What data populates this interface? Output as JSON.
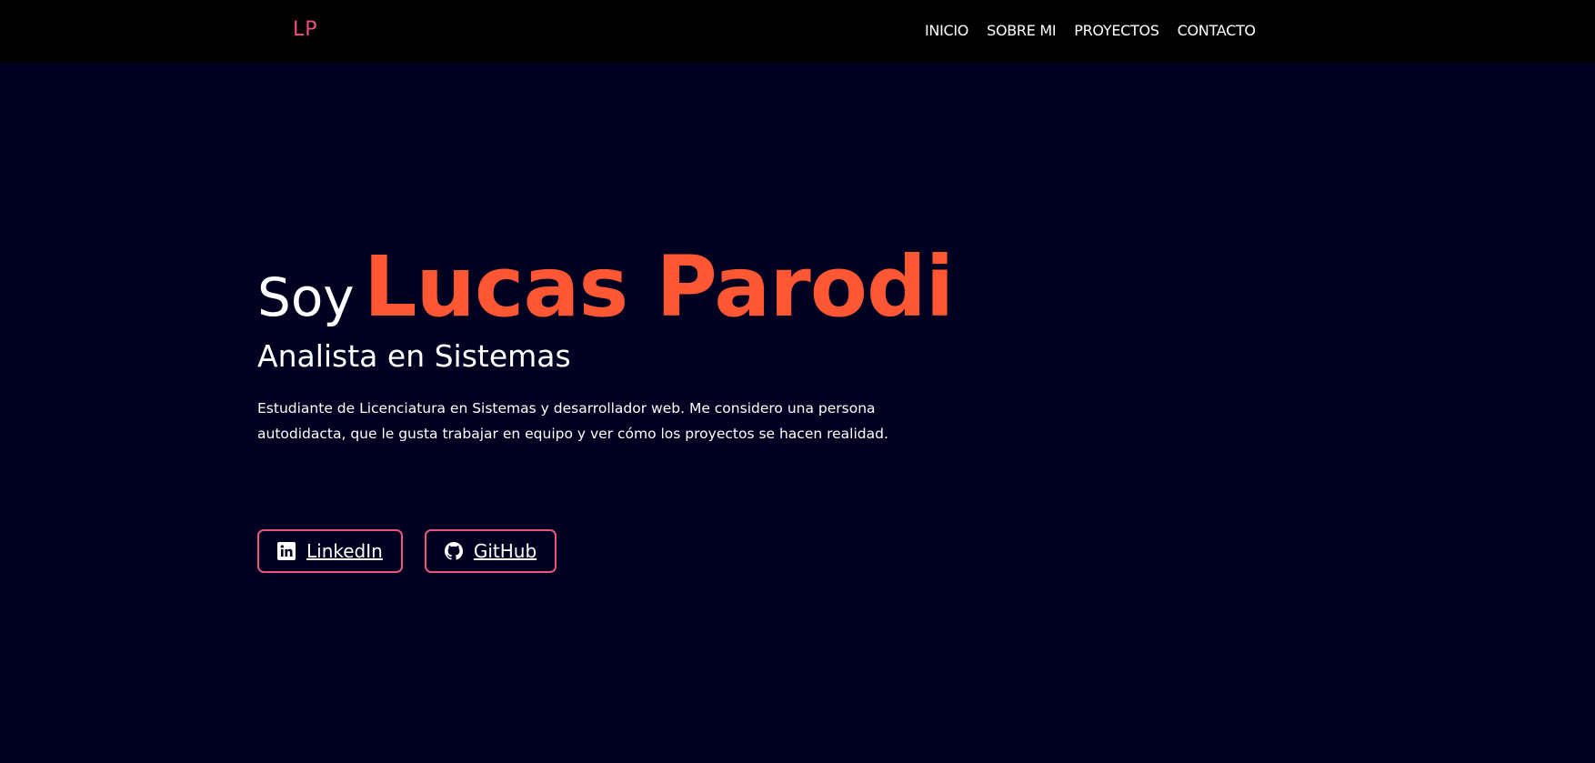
{
  "header": {
    "logo": "LP",
    "nav": [
      "INICIO",
      "SOBRE MI",
      "PROYECTOS",
      "CONTACTO"
    ]
  },
  "hero": {
    "prefix": "Soy",
    "name": "Lucas Parodi",
    "subtitle": "Analista en Sistemas",
    "description": "Estudiante de Licenciatura en Sistemas y desarrollador web. Me considero una persona autodidacta, que le gusta trabajar en equipo y ver cómo los proyectos se hacen realidad.",
    "buttons": [
      {
        "label": "LinkedIn",
        "icon": "linkedin-icon"
      },
      {
        "label": "GitHub",
        "icon": "github-icon"
      }
    ]
  },
  "colors": {
    "background": "#000020",
    "accent": "#ff5733",
    "border": "#e8557f",
    "logo": "#ee4d7d"
  }
}
